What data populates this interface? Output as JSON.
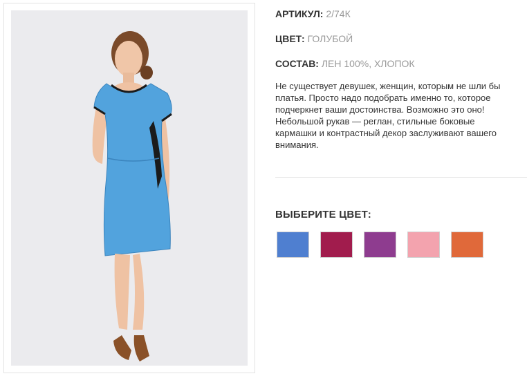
{
  "product": {
    "article_label": "АРТИКУЛ:",
    "article_value": "2/74К",
    "color_label": "ЦВЕТ:",
    "color_value": "ГОЛУБОЙ",
    "composition_label": "СОСТАВ:",
    "composition_value": "ЛЕН 100%, ХЛОПОК",
    "description": "Не существует девушек, женщин, которым не шли бы платья. Просто надо подобрать именно то, которое подчеркнет ваши достоинства. Возможно это оно! Небольшой рукав — реглан, стильные боковые кармашки и контрастный декор заслуживают вашего внимания."
  },
  "color_picker": {
    "title": "ВЫБЕРИТЕ ЦВЕТ:",
    "swatches": [
      "#4f7fd0",
      "#a11c4d",
      "#8e3c8f",
      "#f3a3ae",
      "#e0693a"
    ]
  }
}
